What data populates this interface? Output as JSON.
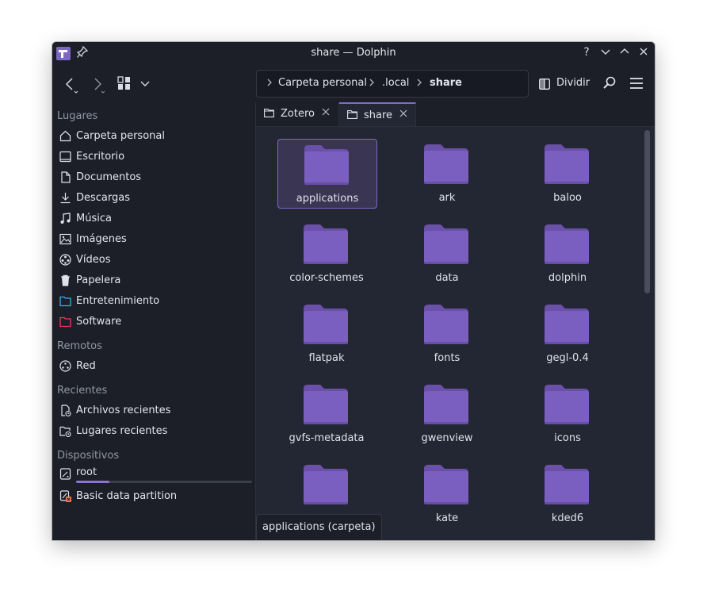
{
  "window": {
    "title": "share — Dolphin",
    "buttons": {
      "help": "?",
      "minimize": "⌄",
      "maximize": "⌃",
      "close": "✕"
    }
  },
  "toolbar": {
    "breadcrumb": [
      "Carpeta personal",
      ".local",
      "share"
    ],
    "split_label": "Dividir"
  },
  "sidebar": {
    "sections": [
      {
        "title": "Lugares"
      },
      {
        "title": "Remotos"
      },
      {
        "title": "Recientes"
      },
      {
        "title": "Dispositivos"
      }
    ],
    "places": [
      {
        "label": "Carpeta personal",
        "icon": "home-icon"
      },
      {
        "label": "Escritorio",
        "icon": "desktop-icon"
      },
      {
        "label": "Documentos",
        "icon": "documents-icon"
      },
      {
        "label": "Descargas",
        "icon": "download-icon"
      },
      {
        "label": "Música",
        "icon": "music-icon"
      },
      {
        "label": "Imágenes",
        "icon": "pictures-icon"
      },
      {
        "label": "Vídeos",
        "icon": "videos-icon"
      },
      {
        "label": "Papelera",
        "icon": "trash-icon"
      },
      {
        "label": "Entretenimiento",
        "icon": "folder-blue-icon"
      },
      {
        "label": "Software",
        "icon": "folder-red-icon"
      }
    ],
    "remote": [
      {
        "label": "Red",
        "icon": "network-icon"
      }
    ],
    "recent": [
      {
        "label": "Archivos recientes",
        "icon": "recent-files-icon"
      },
      {
        "label": "Lugares recientes",
        "icon": "recent-places-icon"
      }
    ],
    "devices": [
      {
        "label": "root",
        "icon": "drive-icon",
        "usage_fraction": 0.19
      },
      {
        "label": "Basic data partition",
        "icon": "drive-warning-icon"
      }
    ]
  },
  "tabs": [
    {
      "label": "Zotero",
      "active": false
    },
    {
      "label": "share",
      "active": true
    }
  ],
  "files": [
    {
      "name": "applications",
      "selected": true
    },
    {
      "name": "ark"
    },
    {
      "name": "baloo"
    },
    {
      "name": "color-schemes"
    },
    {
      "name": "data"
    },
    {
      "name": "dolphin"
    },
    {
      "name": "flatpak"
    },
    {
      "name": "fonts"
    },
    {
      "name": "gegl-0.4"
    },
    {
      "name": "gvfs-metadata"
    },
    {
      "name": "gwenview"
    },
    {
      "name": "icons"
    },
    {
      "name": ""
    },
    {
      "name": "kate"
    },
    {
      "name": "kded6"
    }
  ],
  "statusbar": {
    "text": "applications (carpeta)"
  },
  "colors": {
    "folder": "#7b5fc0",
    "folder_tab": "#6a50a8",
    "accent": "#8067c9",
    "window_bg": "#1c1f28",
    "content_bg": "#232733"
  }
}
